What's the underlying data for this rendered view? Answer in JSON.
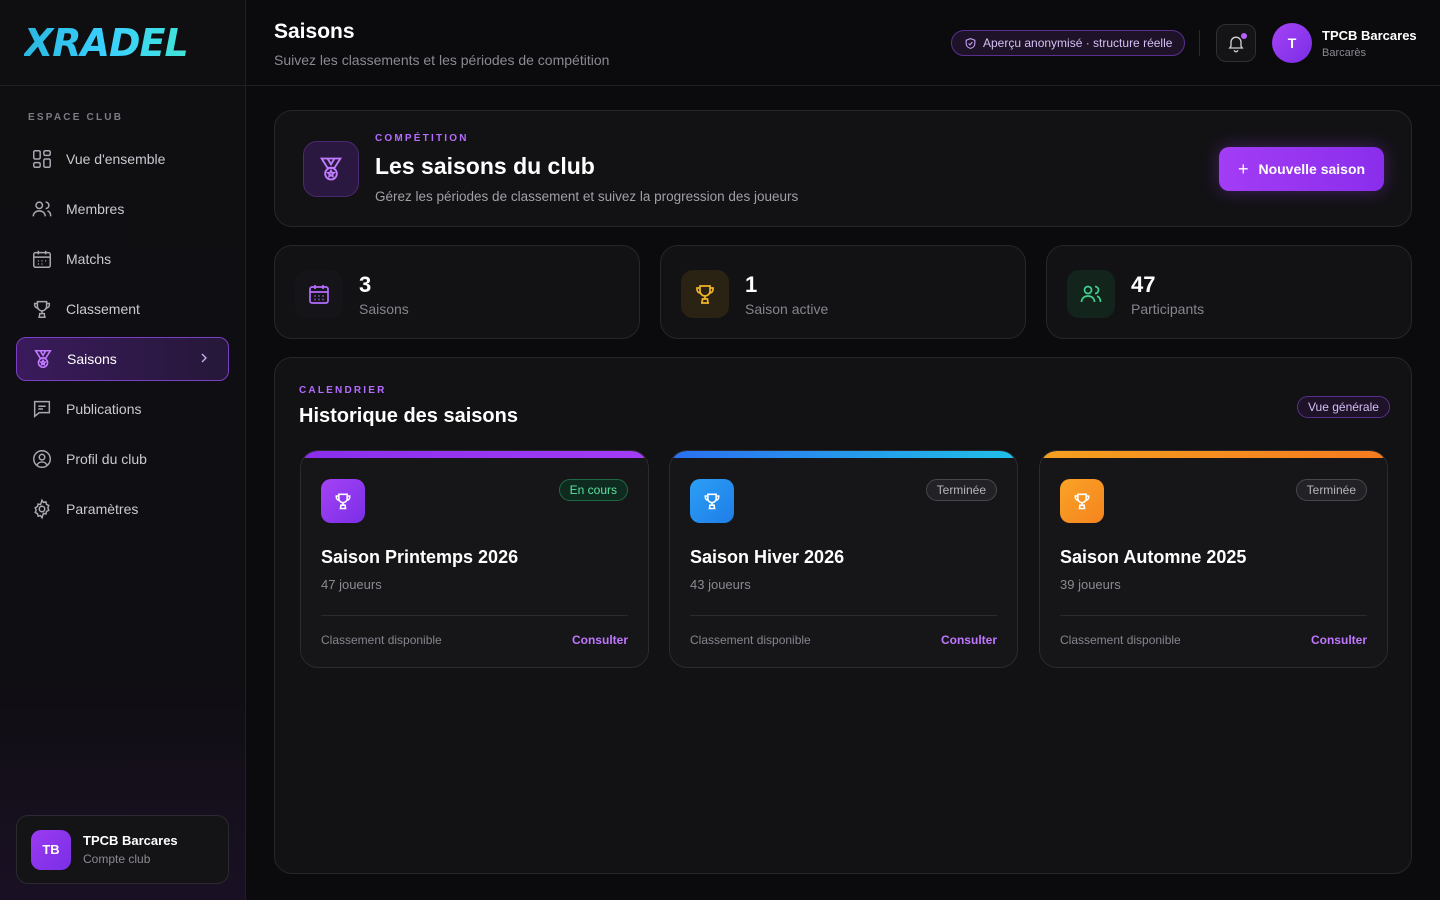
{
  "brand": {
    "logo_text": "XRADEL"
  },
  "sidebar": {
    "section_label": "ESPACE CLUB",
    "items": [
      {
        "label": "Vue d'ensemble",
        "icon": "grid-icon"
      },
      {
        "label": "Membres",
        "icon": "users-icon"
      },
      {
        "label": "Matchs",
        "icon": "calendar-icon"
      },
      {
        "label": "Classement",
        "icon": "trophy-icon"
      },
      {
        "label": "Saisons",
        "icon": "medal-icon",
        "active": true
      },
      {
        "label": "Publications",
        "icon": "message-icon"
      },
      {
        "label": "Profil du club",
        "icon": "user-circle-icon"
      },
      {
        "label": "Paramètres",
        "icon": "gear-icon"
      }
    ],
    "account": {
      "initials": "TB",
      "name": "TPCB Barcares",
      "subtitle": "Compte club"
    }
  },
  "header": {
    "title": "Saisons",
    "subtitle": "Suivez les classements et les périodes de compétition",
    "preview_badge": "Aperçu anonymisé · structure réelle",
    "user": {
      "initial": "T",
      "name": "TPCB Barcares",
      "city": "Barcarès"
    }
  },
  "hero": {
    "kicker": "COMPÉTITION",
    "title": "Les saisons du club",
    "description": "Gérez les périodes de classement et suivez la progression des joueurs",
    "button_label": "Nouvelle saison"
  },
  "stats": [
    {
      "value": "3",
      "label": "Saisons",
      "icon": "calendar-icon",
      "color": "#b46cff"
    },
    {
      "value": "1",
      "label": "Saison active",
      "icon": "trophy-icon",
      "color": "#f0b429"
    },
    {
      "value": "47",
      "label": "Participants",
      "icon": "users-icon",
      "color": "#3fd18f"
    }
  ],
  "history": {
    "kicker": "CALENDRIER",
    "title": "Historique des saisons",
    "badge": "Vue générale",
    "seasons": [
      {
        "name": "Saison Printemps 2026",
        "players": "47 joueurs",
        "status": "En cours",
        "availability": "Classement disponible",
        "link": "Consulter",
        "accent": "#9b3bf0"
      },
      {
        "name": "Saison Hiver 2026",
        "players": "43 joueurs",
        "status": "Terminée",
        "availability": "Classement disponible",
        "link": "Consulter",
        "accent": "#2b8ff0"
      },
      {
        "name": "Saison Automne 2025",
        "players": "39 joueurs",
        "status": "Terminée",
        "availability": "Classement disponible",
        "link": "Consulter",
        "accent": "#f58a1f"
      }
    ]
  }
}
